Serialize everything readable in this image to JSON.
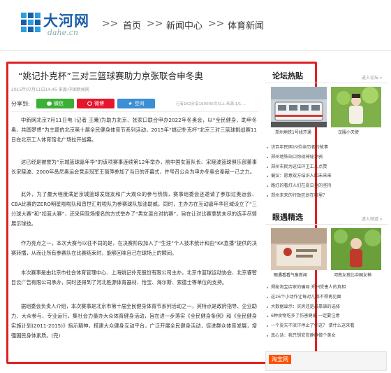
{
  "header": {
    "logo_text": "大河网",
    "logo_sub": "dahe.cn",
    "breadcrumb": [
      "首页",
      "新闻中心",
      "体育新闻"
    ],
    "sep": ">>"
  },
  "colors": {
    "brand": "#1a5ea8",
    "frame": "#e02020",
    "wechat": "#3cb035",
    "weibo": "#e6162d",
    "qzone": "#3c8fd4"
  },
  "article": {
    "title": "“姚记扑克杯”三对三篮球赛助力京张联合申冬奥",
    "meta": "2015年07月11日14:45    来源:中国新闻网",
    "share": {
      "label": "分享到:",
      "buttons": [
        {
          "label": "微信",
          "icon": "wechat-icon"
        },
        {
          "label": "微博",
          "icon": "weibo-icon"
        },
        {
          "label": "空间",
          "icon": "qzone-icon"
        }
      ],
      "count": "已有1K2分享160000次以上 来源:1/1 ..."
    },
    "paragraphs": [
      "中新网北京7月11日电 (记者 王曦)为助力北京、张家口联合申办2022年冬奥会，以“全民健身、助申冬奥、共圆梦想”为主题的北京第十届全民健身体育节系列活动，2015年“姚记扑克杯”北京三对三篮球挑战赛11日在北京工人体育馆北广场拉开战幕。",
      "这已经是被誉为“京城篮球嘉年华”的该项赛事连续第12年举办，前中国女篮队长、宋晓波篮球俱乐部董事长宋晓波、2000年悉尼奥运会竞走冠军王丽萍参加了当日的开幕式，并号召公众为申办冬奥会奉献一己之力。",
      "此外，为了最大程度满足京城篮球发烧友和广大观众的参与热情，赛事组委会还邀请了参加过奥运会、CBA比赛的ZERO明星啦啦队和曾世汇啦啦队为参赛球队加油助威。同时，主办方在互动嘉年华区域设立了“三分球大赛”和“扣篮大赛”，还采用现场报名的方式举办了“男女混合对抗赛”，旨在让对比赛意犹未尽的选手尽情展示球技。",
      "作为亮点之一，本次大赛与以往不同的是，在决赛阶段加入了“生涯”个人技术统计和由“KK直播”提供的决赛转播，从而让所有参赛队在比赛结束时，能够回味自己在球场上的瞬间。",
      "本次赛事是由北京市社会体育管理中心、上海姚记扑克股份有限公司主办，北京市篮球运动协会、北京睿智目云广告有限公司承办，同时还得到了河北胜源体育器材、怡宝、海尔斯、索德士等单位的支持。",
      "据组委会负责人介绍，本次赛事是北京市第十届全民健身体育节系列活动之一，其特点是政府指导、企业助力、大众参与、专业运行，集社会力量办大众体育健身活动，旨在进一步落实《全民健身条例》和《全民健身实施计划(2011-2015)》指示精神，搭建大众健身互动平台，广泛开展全民健身活动，促进群众体育发展，增强国民身体素质。(完)"
    ]
  },
  "sidebar": {
    "forum": {
      "heading": "论坛热贴",
      "more": "进入论坛 »",
      "pics": [
        {
          "caption": "郑州地铁1号线开通"
        },
        {
          "caption": "汉服小天使"
        }
      ],
      "items": [
        "访百年民国19位亲历者的故事",
        "郑州地铁站口惊现神秘涂鸦",
        "郑州市民为这位环卫工人点赞",
        "偏议：愿意双方结识人因未来来",
        "路灯的看灯人们在夏日里的坚持",
        "郑州未来的行政区划在哪里？"
      ]
    },
    "eyes": {
      "heading": "眼遇精选",
      "more": "进入频道 »",
      "pics": [
        {
          "caption": "眼遇看看气象新闻"
        },
        {
          "caption": "河南女孩比中国女神"
        }
      ],
      "items": [
        "揭秘淘宝店家的骗局 郑州受害人的真相",
        "这26个小动作让每对儿都不得再见面",
        "大数据显示：买房还是最靠谱的选择",
        "6种食物吃多了伤害健康 一定要注意",
        "一个夏天不流汗停止了你这？  请什么这来看",
        "真心话：我只想安安静静做个美女"
      ]
    },
    "ad": {
      "badge": "淘宝网"
    }
  }
}
